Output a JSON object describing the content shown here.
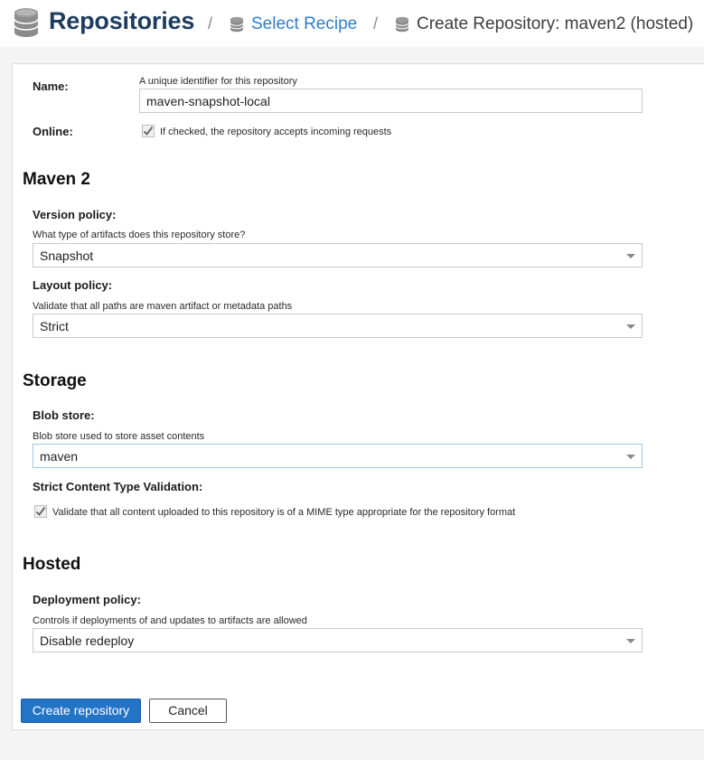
{
  "header": {
    "title": "Repositories",
    "separator": "/",
    "crumb_select": "Select Recipe",
    "crumb_current": "Create Repository: maven2 (hosted)"
  },
  "form": {
    "name": {
      "label": "Name:",
      "help": "A unique identifier for this repository",
      "value": "maven-snapshot-local"
    },
    "online": {
      "label": "Online:",
      "help": "If checked, the repository accepts incoming requests",
      "checked": true
    },
    "maven_section": "Maven 2",
    "version_policy": {
      "label": "Version policy:",
      "help": "What type of artifacts does this repository store?",
      "value": "Snapshot"
    },
    "layout_policy": {
      "label": "Layout policy:",
      "help": "Validate that all paths are maven artifact or metadata paths",
      "value": "Strict"
    },
    "storage_section": "Storage",
    "blob_store": {
      "label": "Blob store:",
      "help": "Blob store used to store asset contents",
      "value": "maven"
    },
    "strict_content": {
      "label": "Strict Content Type Validation:",
      "help": "Validate that all content uploaded to this repository is of a MIME type appropriate for the repository format",
      "checked": true
    },
    "hosted_section": "Hosted",
    "deployment_policy": {
      "label": "Deployment policy:",
      "help": "Controls if deployments of and updates to artifacts are allowed",
      "value": "Disable redeploy"
    }
  },
  "actions": {
    "create_label": "Create repository",
    "cancel_label": "Cancel"
  },
  "colors": {
    "title": "#1d3c5e",
    "link": "#2f7ec9",
    "primary_button": "#2474c6"
  }
}
